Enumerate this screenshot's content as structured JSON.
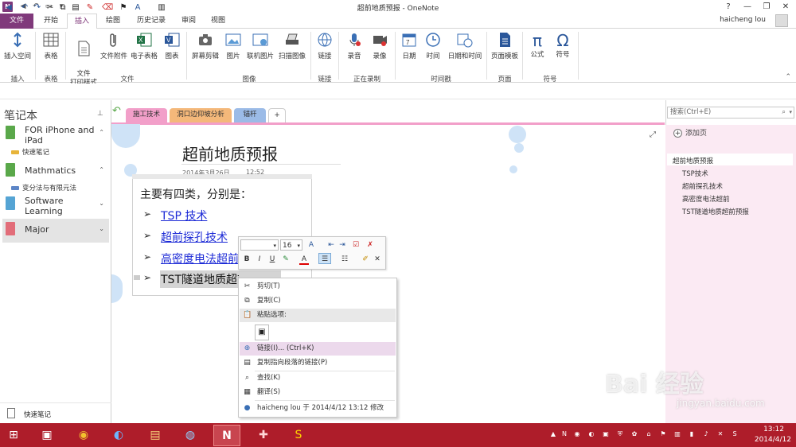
{
  "window": {
    "title": "超前地质预报 - OneNote",
    "user": "haicheng lou",
    "help": "?",
    "minimize": "—",
    "restore": "❐",
    "close": "✕"
  },
  "ribbon_tabs": [
    "文件",
    "开始",
    "插入",
    "绘图",
    "历史记录",
    "审阅",
    "视图"
  ],
  "ribbon": {
    "buttons": [
      {
        "label": "插入空间",
        "icon": "insert-space-icon"
      },
      {
        "label": "表格",
        "icon": "table-icon"
      },
      {
        "label": "文件\n打印样式",
        "icon": "file-printout-icon"
      },
      {
        "label": "文件附件",
        "icon": "attach-icon"
      },
      {
        "label": "电子表格",
        "icon": "spreadsheet-icon"
      },
      {
        "label": "图表",
        "icon": "chart-icon"
      },
      {
        "label": "屏幕剪辑",
        "icon": "screen-clip-icon"
      },
      {
        "label": "图片",
        "icon": "picture-icon"
      },
      {
        "label": "联机图片",
        "icon": "online-picture-icon"
      },
      {
        "label": "扫描图像",
        "icon": "scan-icon"
      },
      {
        "label": "链接",
        "icon": "link-icon"
      },
      {
        "label": "录音",
        "icon": "mic-icon"
      },
      {
        "label": "录像",
        "icon": "video-icon"
      },
      {
        "label": "日期",
        "icon": "calendar-icon"
      },
      {
        "label": "时间",
        "icon": "clock-icon"
      },
      {
        "label": "日期和时间",
        "icon": "datetime-icon"
      },
      {
        "label": "页面模板",
        "icon": "page-template-icon"
      },
      {
        "label": "公式",
        "icon": "pi-icon",
        "glyph": "π"
      },
      {
        "label": "符号",
        "icon": "omega-icon",
        "glyph": "Ω"
      }
    ],
    "groups": [
      "插入",
      "表格",
      "文件",
      "图像",
      "链接",
      "正在录制",
      "时间戳",
      "页面",
      "符号"
    ]
  },
  "notebooks": {
    "title": "笔记本",
    "pin": "📌",
    "items": [
      {
        "name": "FOR iPhone and iPad",
        "color": "#5aa84a",
        "section": "快速笔记",
        "section_color": "#e7b43a"
      },
      {
        "name": "Mathmatics",
        "color": "#5aa84a",
        "section": "变分法与有限元法",
        "section_color": "#5d86c7"
      },
      {
        "name": "Software Learning",
        "color": "#55a4d4"
      },
      {
        "name": "Major",
        "color": "#e26d79"
      }
    ],
    "quick_notes": "快速笔记"
  },
  "section_tabs": [
    {
      "label": "施工技术",
      "color": "#f29fc9"
    },
    {
      "label": "洞口边仰坡分析",
      "color": "#f4b87a"
    },
    {
      "label": "锚杆",
      "color": "#9bbbe7"
    },
    {
      "label": "+",
      "color": "#ffffff"
    }
  ],
  "page": {
    "title": "超前地质预报",
    "date": "2014年3月26日",
    "time": "12:52",
    "intro": "主要有四类，分别是：",
    "bullet": "➢",
    "items": [
      {
        "text": "TSP 技术",
        "link": true
      },
      {
        "text": "超前探孔技术",
        "link": true
      },
      {
        "text": "高密度电法超前",
        "link": true
      },
      {
        "text": "TST隧道地质超前预报",
        "link": false
      }
    ]
  },
  "mini_toolbar": {
    "font": "",
    "size": "16",
    "bold": "B",
    "italic": "I",
    "underline": "U",
    "font_color": "A"
  },
  "context_menu": {
    "items": [
      {
        "label": "剪切(T)",
        "icon": "scissors-icon"
      },
      {
        "label": "复制(C)",
        "icon": "copy-icon"
      },
      {
        "label": "粘贴选项:",
        "icon": "paste-icon"
      },
      {
        "label": "链接(I)...  (Ctrl+K)",
        "icon": "link-icon"
      },
      {
        "label": "复制指向段落的链接(P)",
        "icon": "paragraph-link-icon"
      },
      {
        "label": "查找(K)",
        "icon": "find-icon"
      },
      {
        "label": "翻译(S)",
        "icon": "translate-icon"
      },
      {
        "label": "haicheng lou 于 2014/4/12 13:12 修改",
        "icon": "user-icon"
      }
    ]
  },
  "right_panel": {
    "search_placeholder": "搜索(Ctrl+E)",
    "add_page": "添加页",
    "pages": [
      {
        "title": "超前地质预报",
        "level": 0
      },
      {
        "title": "TSP技术",
        "level": 1
      },
      {
        "title": "超前探孔技术",
        "level": 1
      },
      {
        "title": "高密度电法超前",
        "level": 1
      },
      {
        "title": "TST隧道地质超前预报",
        "level": 1
      }
    ]
  },
  "taskbar": {
    "time": "13:12",
    "date": "2014/4/12"
  },
  "watermark": {
    "main": "Bai 经验",
    "sub": "jingyan.baidu.com"
  }
}
